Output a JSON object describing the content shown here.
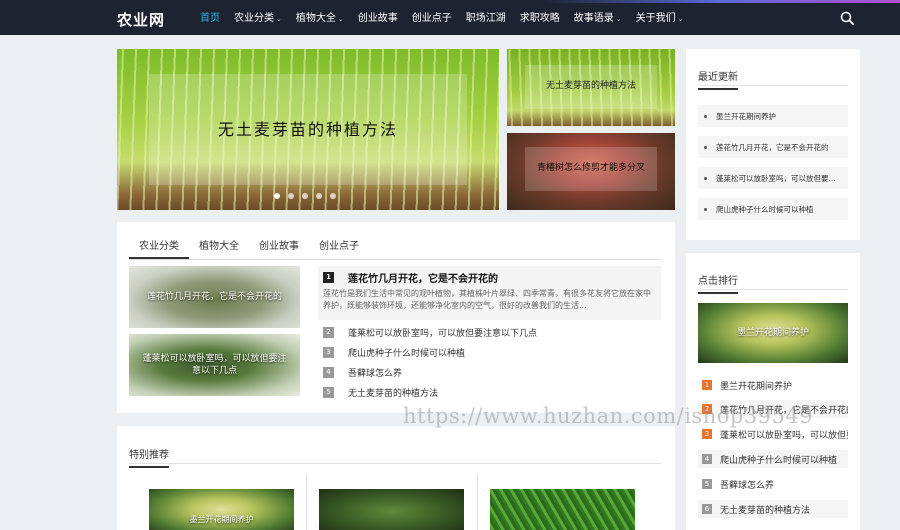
{
  "site": {
    "logo": "农业网"
  },
  "nav": {
    "items": [
      {
        "label": "首页",
        "active": true,
        "caret": false
      },
      {
        "label": "农业分类",
        "caret": true
      },
      {
        "label": "植物大全",
        "caret": true
      },
      {
        "label": "创业故事",
        "caret": false
      },
      {
        "label": "创业点子",
        "caret": false
      },
      {
        "label": "职场江湖",
        "caret": false
      },
      {
        "label": "求职攻略",
        "caret": false
      },
      {
        "label": "故事语录",
        "caret": true
      },
      {
        "label": "关于我们",
        "caret": true
      }
    ],
    "caret_glyph": "⌄",
    "search_icon": "search-icon"
  },
  "slider": {
    "main_caption": "无土麦芽苗的种植方法",
    "side_captions": [
      "无土麦芽苗的种植方法",
      "青椿树怎么修剪才能多分叉"
    ],
    "dot_count": 5,
    "active_dot": 0
  },
  "category_tabs": {
    "tabs": [
      "农业分类",
      "植物大全",
      "创业故事",
      "创业点子"
    ],
    "active": 0,
    "thumbs": [
      "莲花竹几月开花，它是不会开花的",
      "蓬莱松可以放卧室吗，可以放但要注意以下几点"
    ],
    "featured": {
      "num": "1",
      "title": "莲花竹几月开花，它是不会开花的",
      "desc": "莲花竹是我们生活中常见的观叶植物，其植株叶片翠绿、四季常青，有很多花友将它放在家中养护，既能够装饰环境，还能够净化室内的空气，很好的改善我们的生活..."
    },
    "list": [
      {
        "num": "2",
        "title": "蓬莱松可以放卧室吗，可以放但要注意以下几点"
      },
      {
        "num": "3",
        "title": "爬山虎种子什么时候可以种植"
      },
      {
        "num": "4",
        "title": "吾藓球怎么养"
      },
      {
        "num": "5",
        "title": "无土麦芽苗的种植方法"
      }
    ]
  },
  "special": {
    "title": "特别推荐",
    "items": [
      "墨兰开花期间养护"
    ]
  },
  "recent": {
    "title": "最近更新",
    "items": [
      "墨兰开花期间养护",
      "莲花竹几月开花，它是不会开花的",
      "蓬莱松可以放卧室吗，可以放但要...",
      "爬山虎种子什么时候可以种植"
    ]
  },
  "ranking": {
    "title": "点击排行",
    "thumb_caption": "墨兰开花期间养护",
    "items": [
      {
        "num": "1",
        "title": "墨兰开花期间养护"
      },
      {
        "num": "2",
        "title": "莲花竹几月开花，它是不会开花的"
      },
      {
        "num": "3",
        "title": "蓬莱松可以放卧室吗，可以放但要注意以下几点"
      },
      {
        "num": "4",
        "title": "爬山虎种子什么时候可以种植"
      },
      {
        "num": "5",
        "title": "吾藓球怎么养"
      },
      {
        "num": "6",
        "title": "无土麦芽苗的种植方法"
      }
    ],
    "rank_colors": [
      "#e8732c",
      "#e8732c",
      "#e8732c",
      "#999999",
      "#999999",
      "#999999"
    ]
  },
  "watermark": "https://www.huzhan.com/ishop39549"
}
